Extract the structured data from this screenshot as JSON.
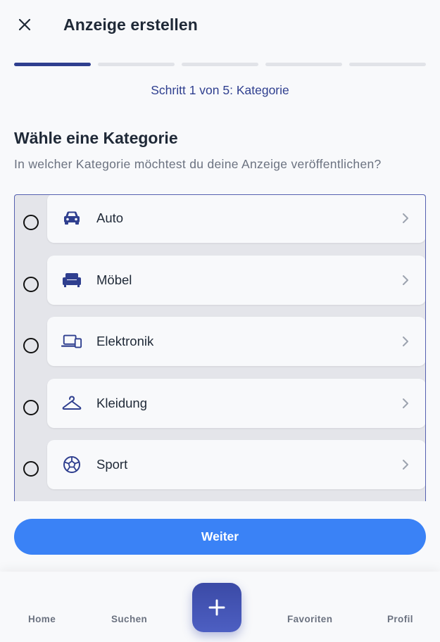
{
  "header": {
    "title": "Anzeige erstellen",
    "close_icon": "close-icon"
  },
  "progress": {
    "current_step": 1,
    "total_steps": 5,
    "label": "Schritt 1 von 5: Kategorie"
  },
  "section": {
    "title": "Wähle eine Kategorie",
    "subtitle": "In welcher Kategorie möchtest du deine Anzeige veröffentlichen?"
  },
  "categories": [
    {
      "label": "Auto",
      "icon": "car-icon"
    },
    {
      "label": "Möbel",
      "icon": "sofa-icon"
    },
    {
      "label": "Elektronik",
      "icon": "devices-icon"
    },
    {
      "label": "Kleidung",
      "icon": "hanger-icon"
    },
    {
      "label": "Sport",
      "icon": "ball-icon"
    }
  ],
  "actions": {
    "next_label": "Weiter"
  },
  "bottom_nav": {
    "items": [
      {
        "label": "Home"
      },
      {
        "label": "Suchen"
      },
      {
        "label": "Favoriten"
      },
      {
        "label": "Profil"
      }
    ],
    "fab_icon": "plus-icon"
  },
  "colors": {
    "primary": "#2f3f8f",
    "accent_button": "#3a82f6",
    "background": "#f8f9fb",
    "progress_inactive": "#e1e3e8",
    "list_background": "#e4e5ea"
  }
}
